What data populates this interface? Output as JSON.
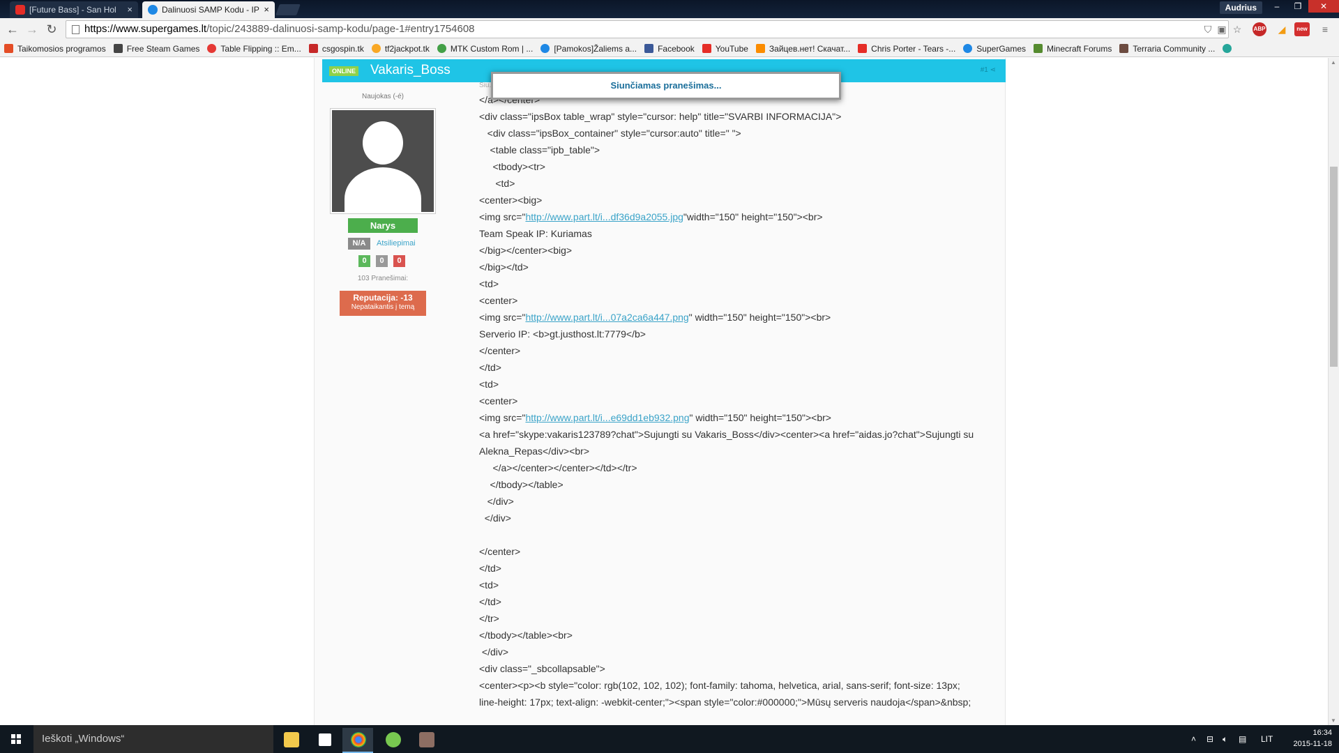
{
  "browser": {
    "tabs": [
      {
        "label": "[Future Bass] - San Hol",
        "icon": "youtube-icon",
        "active": false
      },
      {
        "label": "Dalinuosi SAMP Kodu - IP",
        "icon": "supergames-icon",
        "active": true
      }
    ],
    "user": "Audrius",
    "url_host": "https://www.supergames.lt",
    "url_path": "/topic/243889-dalinuosi-samp-kodu/page-1#entry1754608",
    "bookmarks": [
      {
        "label": "Taikomosios programos",
        "color": "#e44d26"
      },
      {
        "label": "Free Steam Games",
        "color": "#444444"
      },
      {
        "label": "Table Flipping :: Em...",
        "color": "#e53935"
      },
      {
        "label": "csgospin.tk",
        "color": "#c62828"
      },
      {
        "label": "tf2jackpot.tk",
        "color": "#f9a825"
      },
      {
        "label": "MTK Custom Rom | ...",
        "color": "#43a047"
      },
      {
        "label": "[Pamokos]Žaliems a...",
        "color": "#1e88e5"
      },
      {
        "label": "Facebook",
        "color": "#3b5998"
      },
      {
        "label": "YouTube",
        "color": "#e52d27"
      },
      {
        "label": "Зайцев.нет! Скачат...",
        "color": "#fb8c00"
      },
      {
        "label": "Chris Porter - Tears -...",
        "color": "#e52d27"
      },
      {
        "label": "SuperGames",
        "color": "#1e88e5"
      },
      {
        "label": "Minecraft Forums",
        "color": "#558b2f"
      },
      {
        "label": "Terraria Community ...",
        "color": "#6d4c41"
      }
    ],
    "ext_abp": "ABP",
    "ext_new": "new"
  },
  "post": {
    "status": "ONLINE",
    "author": "Vakaris_Boss",
    "post_num": "#1",
    "rank_title": "Naujokas (-é)",
    "group": "Narys",
    "feedback_na": "N/A",
    "feedback_link": "Atsiliepimai",
    "counts": [
      "0",
      "0",
      "0"
    ],
    "posts_count": "103 Pranešimai:",
    "reputation": "Reputacija: -13",
    "reputation_note": "Nepataikantis į temą",
    "meta_partial": "Siu..."
  },
  "popup": {
    "message": "Siunčiamas pranešimas..."
  },
  "code_lines": [
    "</a></center>",
    "<div class=\"ipsBox table_wrap\" style=\"cursor: help\" title=\"SVARBI INFORMACIJA\">",
    "   <div class=\"ipsBox_container\" style=\"cursor:auto\" title=\" \">",
    "    <table class=\"ipb_table\">",
    "     <tbody><tr>",
    "      <td>",
    "<center><big>",
    "LINK1",
    "Team Speak IP: Kuriamas",
    "</big></center><big>",
    "</big></td>",
    "<td>",
    "<center>",
    "LINK2",
    "Serverio IP: <b>gt.justhost.lt:7779</b>",
    "</center>",
    "</td>",
    "<td>",
    "<center>",
    "LINK3",
    "WRAP",
    "     </a></center></center></td></tr>",
    "    </tbody></table>",
    "   </div>",
    "  </div>",
    "",
    "</center>",
    "</td>",
    "<td>",
    "</td>",
    "</tr>",
    "</tbody></table><br>",
    " </div>",
    "<div class=\"_sbcollapsable\">",
    "<center><p><b style=\"color: rgb(102, 102, 102); font-family: tahoma, helvetica, arial, sans-serif; font-size: 13px;",
    "line-height: 17px; text-align: -webkit-center;\"><span style=\"color:#000000;\">Mūsų serveris naudoja</span>&nbsp;"
  ],
  "code_links": {
    "link1": {
      "pre": "<img src=\"",
      "url": "http://www.part.lt/i...df36d9a2055.jpg",
      "post": "\"width=\"150\" height=\"150\"><br>"
    },
    "link2": {
      "pre": "<img src=\"",
      "url": "http://www.part.lt/i...07a2ca6a447.png",
      "post": "\" width=\"150\" height=\"150\"><br>"
    },
    "link3": {
      "pre": "<img src=\"",
      "url": "http://www.part.lt/i...e69dd1eb932.png",
      "post": "\" width=\"150\" height=\"150\"><br>"
    }
  },
  "code_wrap": "<a href=\"skype:vakaris123789?chat\">Sujungti su Vakaris_Boss</div><center><a href=\"aidas.jo?chat\">Sujungti su Alekna_Repas</div><br>",
  "taskbar": {
    "search_placeholder": "Ieškoti „Windows“",
    "language": "LIT",
    "time": "16:34",
    "date": "2015-11-18"
  }
}
